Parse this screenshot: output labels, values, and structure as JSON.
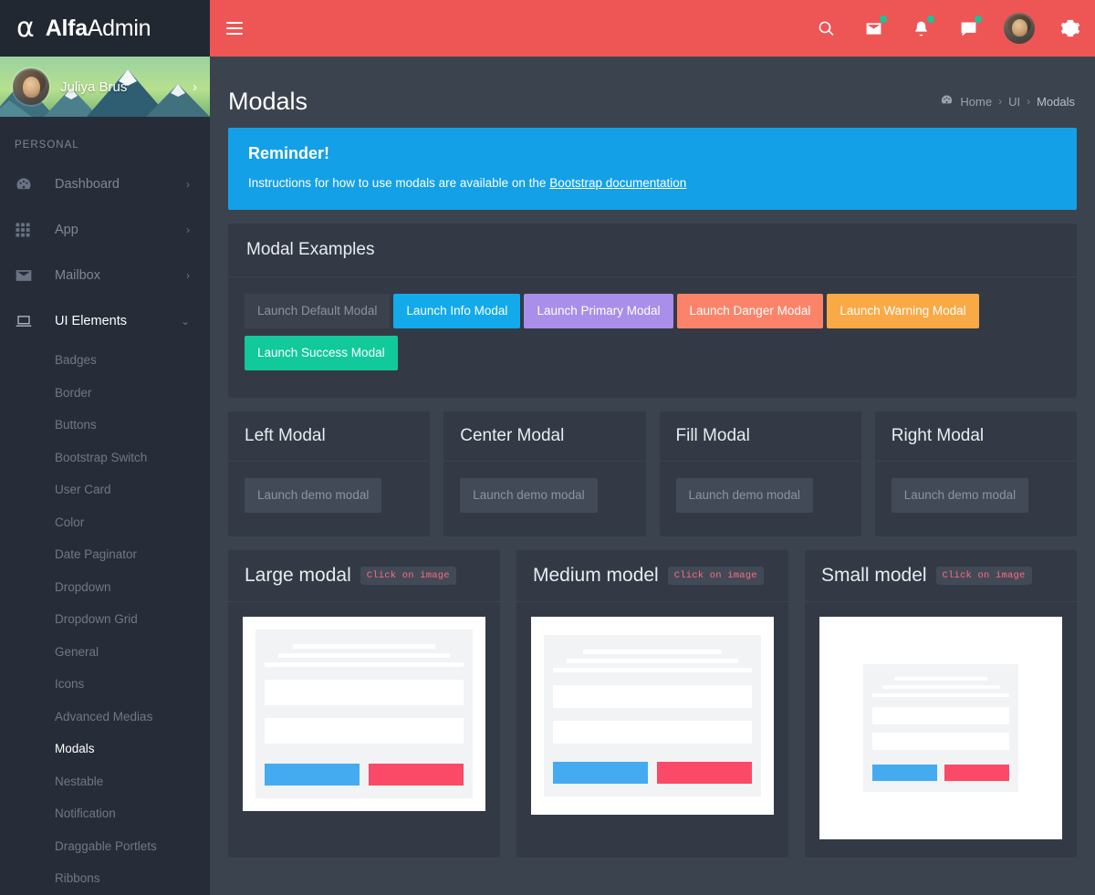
{
  "brand": {
    "logo_glyph": "α",
    "name_bold": "Alfa",
    "name_light": "Admin"
  },
  "topnav": {
    "menu_toggle": "hamburger-menu",
    "icons": [
      "search-icon",
      "mail-icon",
      "bell-icon",
      "chat-icon",
      "avatar",
      "gear-icon"
    ]
  },
  "sidebar": {
    "profile": {
      "name": "Juliya Brus",
      "arrow": "›"
    },
    "section_label": "PERSONAL",
    "items": [
      {
        "label": "Dashboard",
        "icon": "dashboard-icon",
        "caret": "›",
        "active": false
      },
      {
        "label": "App",
        "icon": "grid-icon",
        "caret": "›",
        "active": false
      },
      {
        "label": "Mailbox",
        "icon": "envelope-icon",
        "caret": "›",
        "active": false
      },
      {
        "label": "UI Elements",
        "icon": "laptop-icon",
        "caret": "⌄",
        "active": true
      }
    ],
    "sub_items": [
      {
        "label": "Badges",
        "active": false
      },
      {
        "label": "Border",
        "active": false
      },
      {
        "label": "Buttons",
        "active": false
      },
      {
        "label": "Bootstrap Switch",
        "active": false
      },
      {
        "label": "User Card",
        "active": false
      },
      {
        "label": "Color",
        "active": false
      },
      {
        "label": "Date Paginator",
        "active": false
      },
      {
        "label": "Dropdown",
        "active": false
      },
      {
        "label": "Dropdown Grid",
        "active": false
      },
      {
        "label": "General",
        "active": false
      },
      {
        "label": "Icons",
        "active": false
      },
      {
        "label": "Advanced Medias",
        "active": false
      },
      {
        "label": "Modals",
        "active": true
      },
      {
        "label": "Nestable",
        "active": false
      },
      {
        "label": "Notification",
        "active": false
      },
      {
        "label": "Draggable Portlets",
        "active": false
      },
      {
        "label": "Ribbons",
        "active": false
      }
    ]
  },
  "page": {
    "title": "Modals",
    "breadcrumb": {
      "home": "Home",
      "sep1": "›",
      "ui": "UI",
      "sep2": "›",
      "current": "Modals"
    }
  },
  "alert": {
    "heading": "Reminder!",
    "text_before": "Instructions for how to use modals are available on the ",
    "link": "Bootstrap documentation",
    "color": "#14a0e6"
  },
  "modal_examples": {
    "title": "Modal Examples",
    "buttons": [
      {
        "label": "Launch Default Modal",
        "style": "default",
        "color": "#3b424e"
      },
      {
        "label": "Launch Info Modal",
        "style": "info",
        "color": "#12aaeb"
      },
      {
        "label": "Launch Primary Modal",
        "style": "primary",
        "color": "#a98eea"
      },
      {
        "label": "Launch Danger Modal",
        "style": "danger",
        "color": "#fb8369"
      },
      {
        "label": "Launch Warning Modal",
        "style": "warning",
        "color": "#f9a945"
      },
      {
        "label": "Launch Success Modal",
        "style": "success",
        "color": "#12c99b"
      }
    ]
  },
  "position_cards": [
    {
      "title": "Left Modal",
      "button": "Launch demo modal"
    },
    {
      "title": "Center Modal",
      "button": "Launch demo modal"
    },
    {
      "title": "Fill Modal",
      "button": "Launch demo modal"
    },
    {
      "title": "Right Modal",
      "button": "Launch demo modal"
    }
  ],
  "size_cards": [
    {
      "title": "Large modal",
      "badge": "Click on image",
      "size": "large"
    },
    {
      "title": "Medium model",
      "badge": "Click on image",
      "size": "medium"
    },
    {
      "title": "Small model",
      "badge": "Click on image",
      "size": "small"
    }
  ],
  "colors": {
    "topbar": "#ee5555",
    "brand_bg": "#222831",
    "sidebar_bg": "#262d38",
    "content_bg": "#3b434f",
    "card_bg": "#333a46",
    "badge_text": "#fb6b7e",
    "mock_blue": "#45abf0",
    "mock_red": "#fb4a68"
  }
}
